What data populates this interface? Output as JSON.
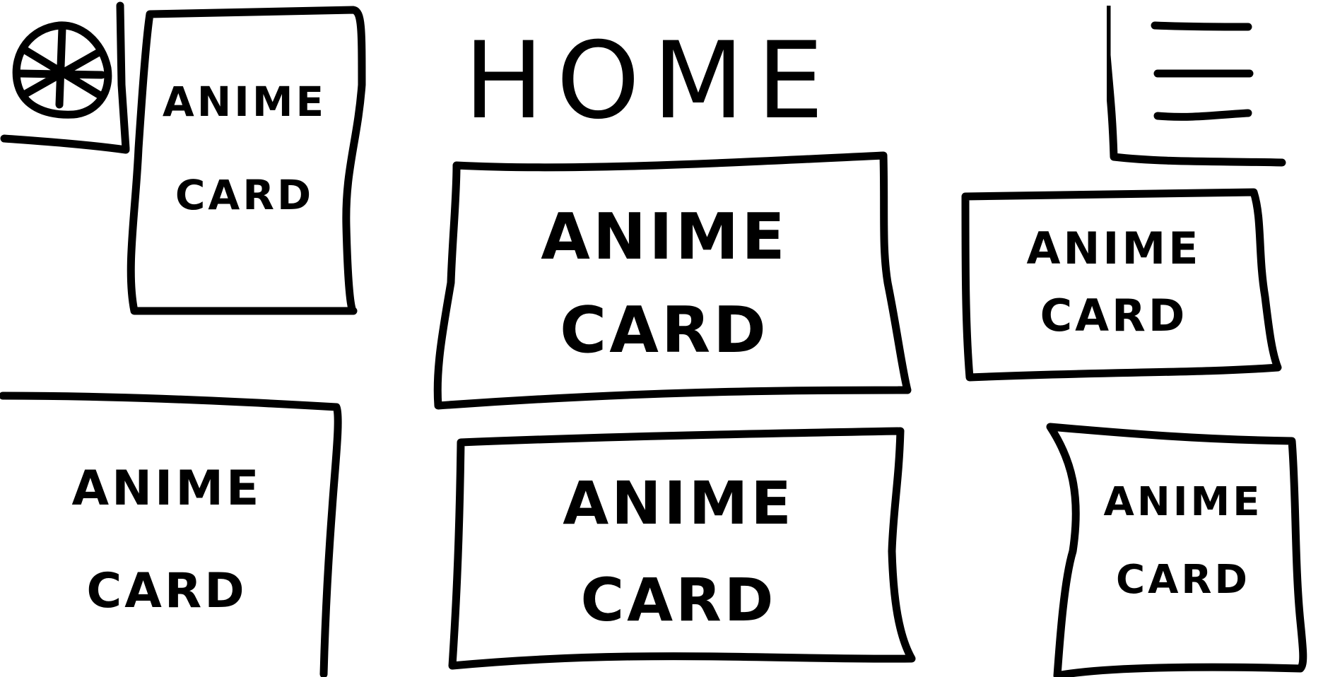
{
  "header": {
    "title": "HOME",
    "logo_icon": "wheel-icon",
    "menu_icon": "hamburger-menu-icon"
  },
  "cards": [
    {
      "line1": "ANIME",
      "line2": "CARD"
    },
    {
      "line1": "ANIME",
      "line2": "CARD"
    },
    {
      "line1": "ANIME",
      "line2": "CARD"
    },
    {
      "line1": "ANIME",
      "line2": "CARD"
    },
    {
      "line1": "ANIME",
      "line2": "CARD"
    },
    {
      "line1": "ANIME",
      "line2": "CARD"
    }
  ]
}
